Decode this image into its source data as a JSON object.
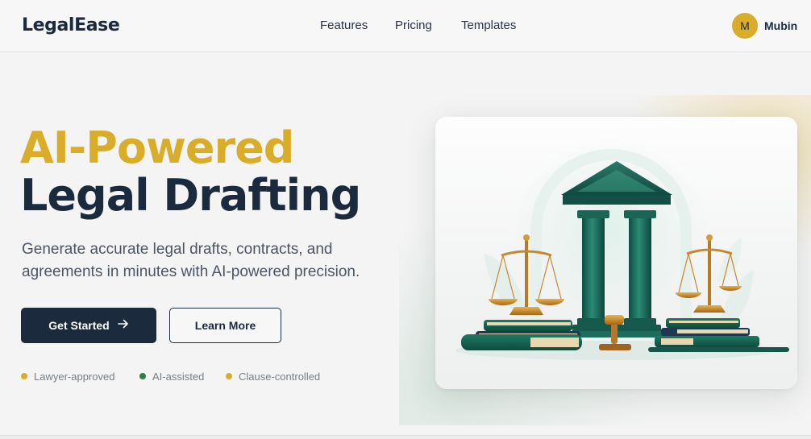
{
  "nav": {
    "brand": "LegalEase",
    "links": [
      "Features",
      "Pricing",
      "Templates"
    ],
    "user": {
      "initial": "M",
      "name": "Mubin"
    }
  },
  "hero": {
    "headline_accent": "AI-Powered",
    "headline_main": "Legal Drafting",
    "subtext": "Generate accurate legal drafts, contracts, and agreements in minutes with AI-powered precision.",
    "primary_cta": "Get Started",
    "primary_cta_icon": "arrow-right-icon",
    "secondary_cta": "Learn More",
    "features": [
      {
        "label": "Lawyer-approved",
        "dot_color": "#d9ac2a"
      },
      {
        "label": "AI-assisted",
        "dot_color": "#2e7d4f"
      },
      {
        "label": "Clause-controlled",
        "dot_color": "#d9ac2a"
      }
    ]
  },
  "colors": {
    "navy": "#1c2a3d",
    "gold": "#d9ac2a",
    "teal": "#1f7060"
  },
  "illustration": "scales-of-justice-with-columns-and-books"
}
